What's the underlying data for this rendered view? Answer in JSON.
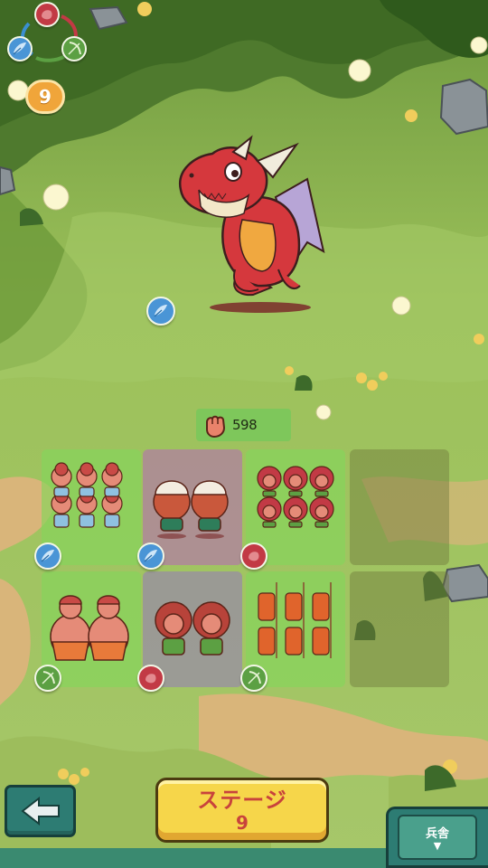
{
  "hud": {
    "element_cycle": {
      "top_icon": "fire-icon",
      "left_icon": "wind-feather-icon",
      "right_icon": "bow-icon"
    },
    "stage_counter": "9"
  },
  "enemy": {
    "name_icon": "red-dragon",
    "element_icon": "wind-feather-icon"
  },
  "formation": {
    "power_icon": "fist-icon",
    "power_value": "598",
    "slots": [
      {
        "row": 1,
        "col": 1,
        "unit": "caveman-children-squad",
        "count": 9,
        "element": "wind-feather-icon",
        "state": "filled"
      },
      {
        "row": 1,
        "col": 2,
        "unit": "skull-helmet-warriors",
        "count": 2,
        "element": "wind-feather-icon",
        "state": "selected"
      },
      {
        "row": 1,
        "col": 3,
        "unit": "club-cavemen-squad",
        "count": 6,
        "element": "fire-icon",
        "state": "filled"
      },
      {
        "row": 1,
        "col": 4,
        "unit": "",
        "state": "empty"
      },
      {
        "row": 2,
        "col": 1,
        "unit": "big-cavemen",
        "count": 2,
        "element": "bow-icon",
        "state": "filled"
      },
      {
        "row": 2,
        "col": 2,
        "unit": "bear-hood-fighters",
        "count": 2,
        "element": "fire-icon",
        "state": "selected"
      },
      {
        "row": 2,
        "col": 3,
        "unit": "spear-cavemen-squad",
        "count": 9,
        "element": "bow-icon",
        "state": "filled"
      },
      {
        "row": 2,
        "col": 4,
        "unit": "",
        "state": "empty"
      }
    ]
  },
  "controls": {
    "back_icon": "back-arrow-icon",
    "stage_label": "ステージ",
    "stage_number": "9",
    "barracks_label": "兵舎",
    "barracks_arrow": "▼"
  },
  "colors": {
    "wind": "#4a95d6",
    "bow": "#5ca043",
    "fire": "#c23a45",
    "stage_button": "#f6d64a",
    "stage_text": "#c8433c",
    "panel_teal": "#2d7c73"
  }
}
